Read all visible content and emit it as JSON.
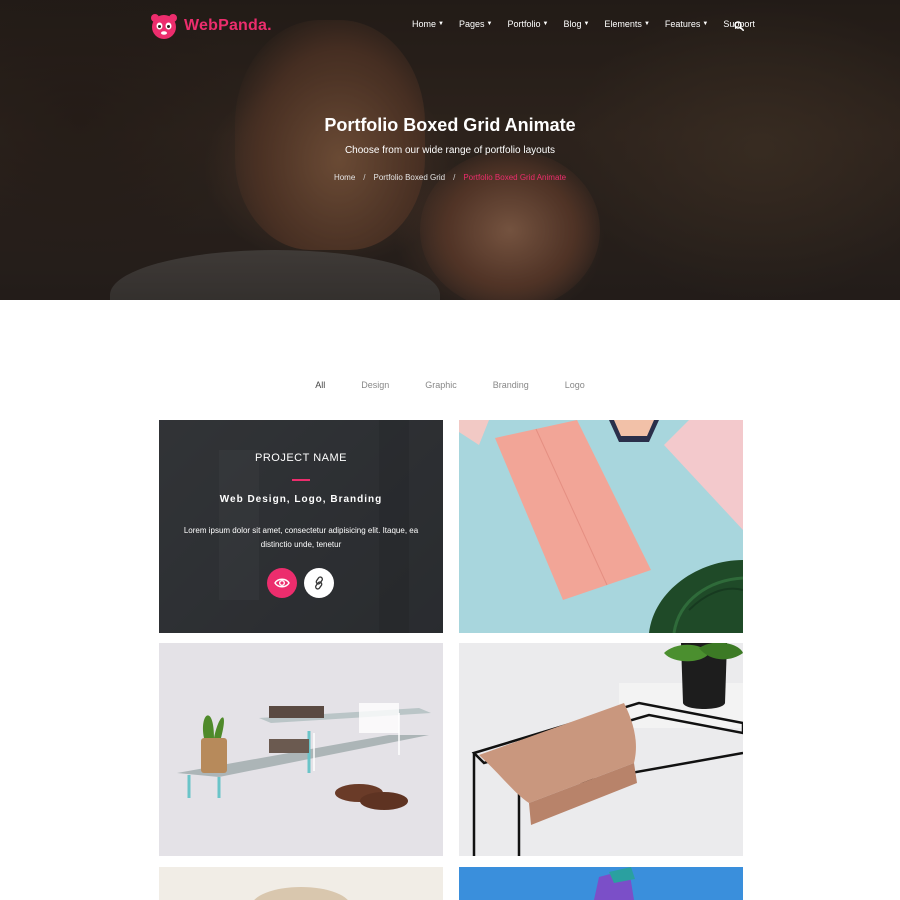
{
  "brand": {
    "logo_text": "WebPanda.",
    "accent": "#ec2d6d"
  },
  "nav": {
    "items": [
      {
        "label": "Home",
        "has_caret": true
      },
      {
        "label": "Pages",
        "has_caret": true
      },
      {
        "label": "Portfolio",
        "has_caret": true
      },
      {
        "label": "Blog",
        "has_caret": true
      },
      {
        "label": "Elements",
        "has_caret": true
      },
      {
        "label": "Features",
        "has_caret": true
      },
      {
        "label": "Support",
        "has_caret": false
      }
    ],
    "search_icon": "search-icon"
  },
  "hero": {
    "title": "Portfolio Boxed Grid Animate",
    "subtitle": "Choose from our wide range of portfolio layouts",
    "breadcrumb": [
      "Home",
      "Portfolio Boxed Grid",
      "Portfolio Boxed Grid Animate"
    ],
    "breadcrumb_separator": "/"
  },
  "filters": {
    "items": [
      "All",
      "Design",
      "Graphic",
      "Branding",
      "Logo"
    ],
    "active": "All"
  },
  "portfolio": {
    "hover_item": {
      "title": "PROJECT NAME",
      "categories": "Web Design, Logo, Branding",
      "description": "Lorem ipsum dolor sit amet, consectetur adipisicing elit. Itaque, ea distinctio unde, tenetur",
      "view_icon": "eye-icon",
      "link_icon": "link-icon"
    }
  }
}
